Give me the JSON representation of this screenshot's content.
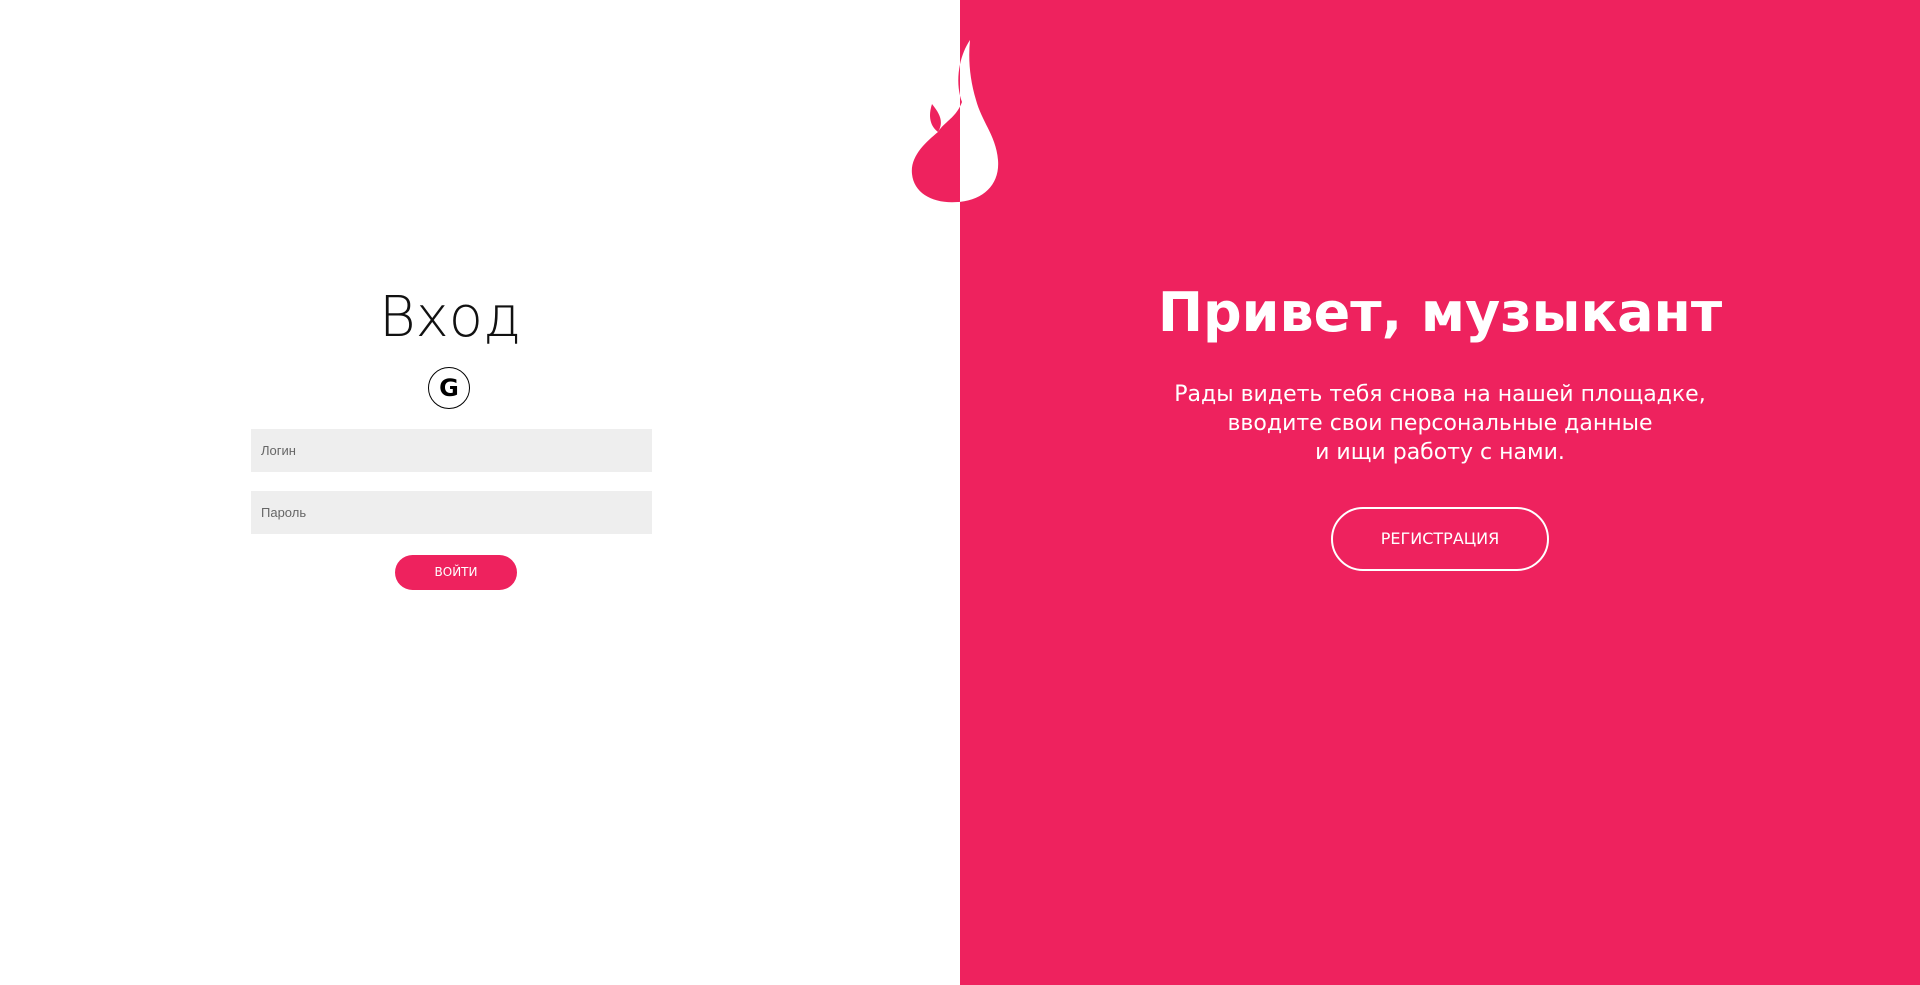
{
  "brand": {
    "logo_icon": "flame-icon",
    "accent_color": "#ee225e"
  },
  "login": {
    "title": "Вход",
    "google_icon": "google-icon",
    "google_glyph": "G",
    "login_placeholder": "Логин",
    "login_value": "",
    "password_placeholder": "Пароль",
    "password_value": "",
    "submit_label": "ВОЙТИ"
  },
  "welcome": {
    "title": "Привет, музыкант",
    "text_lines": [
      "Рады видеть тебя снова на нашей площадке,",
      "вводите свои персональные данные",
      "и ищи работу с нами."
    ],
    "register_label": "РЕГИСТРАЦИЯ"
  }
}
